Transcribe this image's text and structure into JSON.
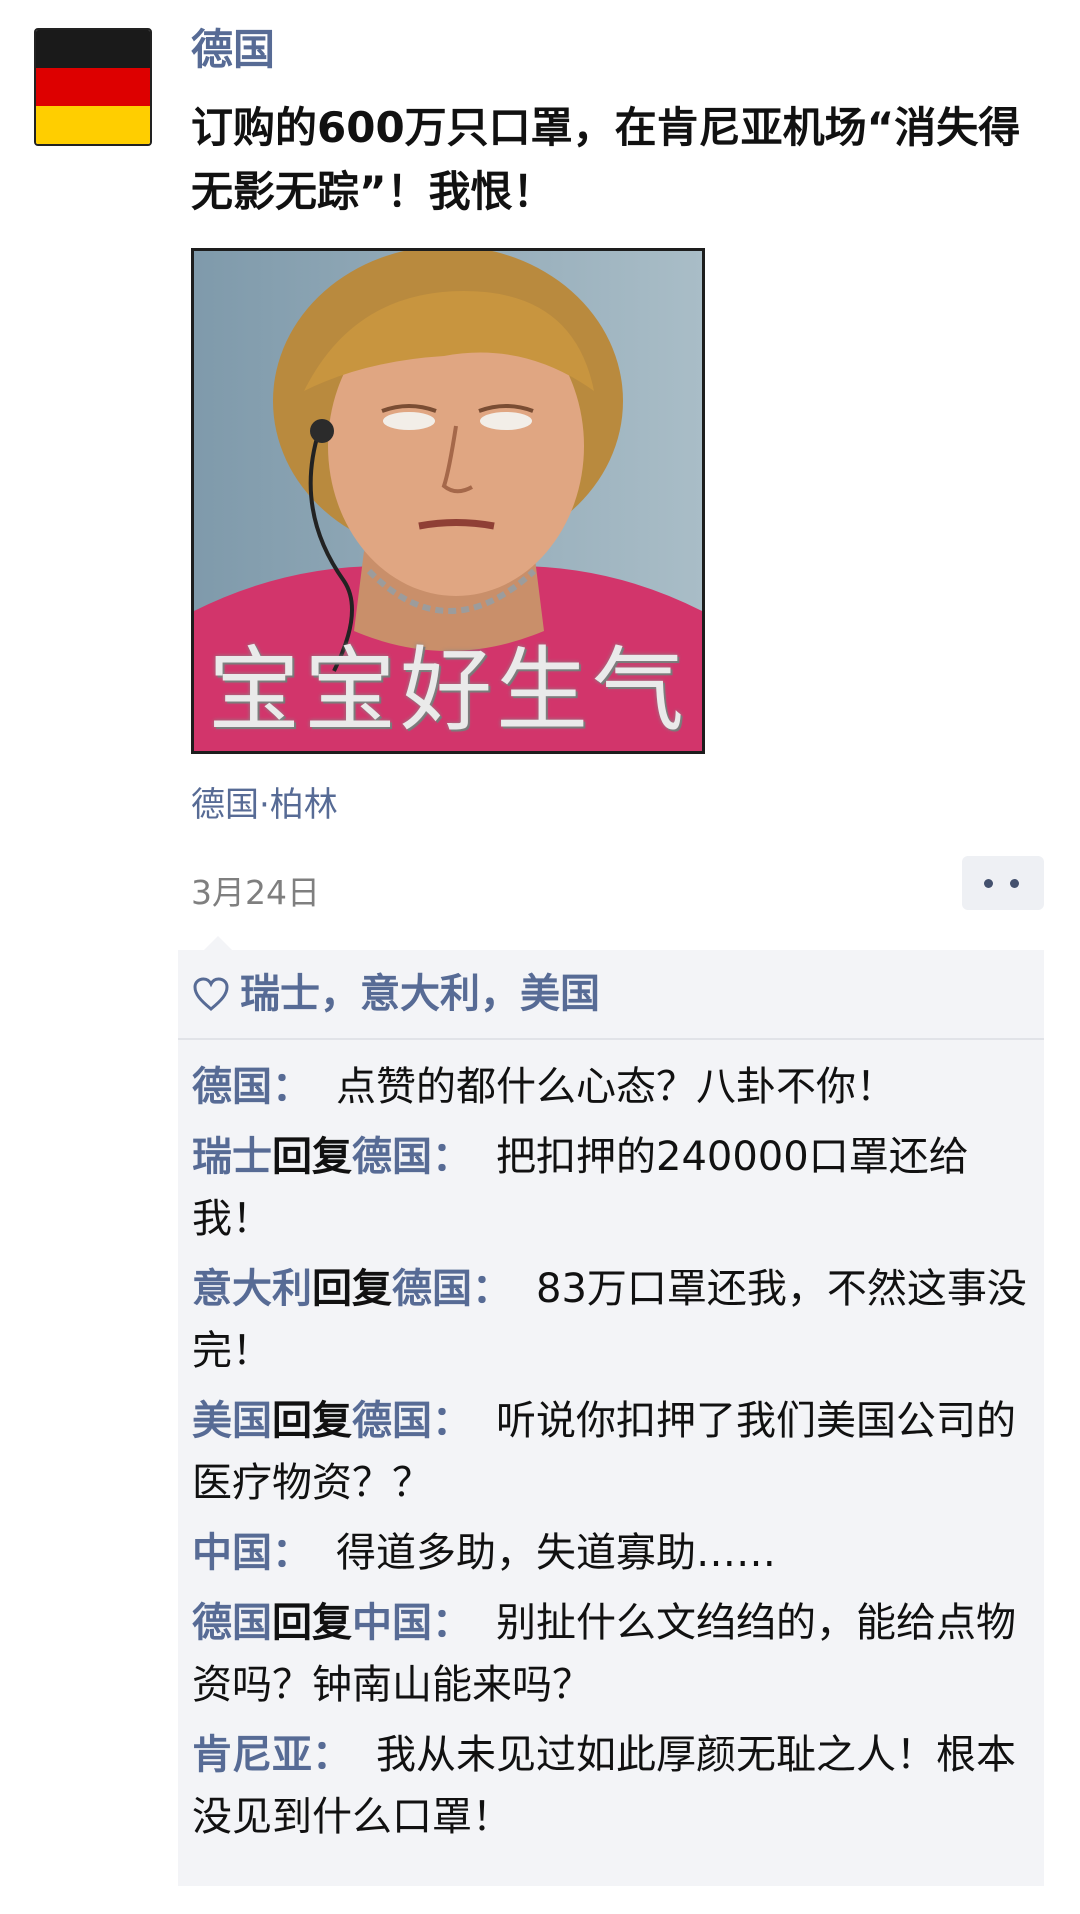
{
  "post": {
    "username": "德国",
    "avatar": {
      "icon": "germany-flag-icon",
      "colors": [
        "#1a1a1a",
        "#dd0000",
        "#ffce00"
      ]
    },
    "text": "订购的600万只口罩，在肯尼亚机场“消失得无影无踪”！我恨！",
    "image": {
      "caption": "宝宝好生气"
    },
    "location": "德国·柏林",
    "date": "3月24日"
  },
  "likes": {
    "icon": "heart-icon",
    "names": "瑞士，意大利，美国"
  },
  "comments": [
    {
      "author": "德国",
      "reply_word": "",
      "target": "",
      "colon": "：",
      "text": "点赞的都什么心态？八卦不你！"
    },
    {
      "author": "瑞士",
      "reply_word": "回复",
      "target": "德国",
      "colon": "：",
      "text": "把扣押的240000口罩还给我！"
    },
    {
      "author": "意大利",
      "reply_word": "回复",
      "target": "德国",
      "colon": "：",
      "text": "83万口罩还我，不然这事没完！"
    },
    {
      "author": "美国",
      "reply_word": "回复",
      "target": "德国",
      "colon": "：",
      "text": "听说你扣押了我们美国公司的医疗物资？？"
    },
    {
      "author": "中国",
      "reply_word": "",
      "target": "",
      "colon": "：",
      "text": "得道多助，失道寡助……"
    },
    {
      "author": "德国",
      "reply_word": "回复",
      "target": "中国",
      "colon": "：",
      "text": "别扯什么文绉绉的，能给点物资吗？钟南山能来吗？"
    },
    {
      "author": "肯尼亚",
      "reply_word": "",
      "target": "",
      "colon": "：",
      "text": "我从未见过如此厚颜无耻之人！根本没见到什么口罩！"
    }
  ],
  "colors": {
    "link": "#576b95",
    "panel_bg": "#f3f4f7"
  }
}
